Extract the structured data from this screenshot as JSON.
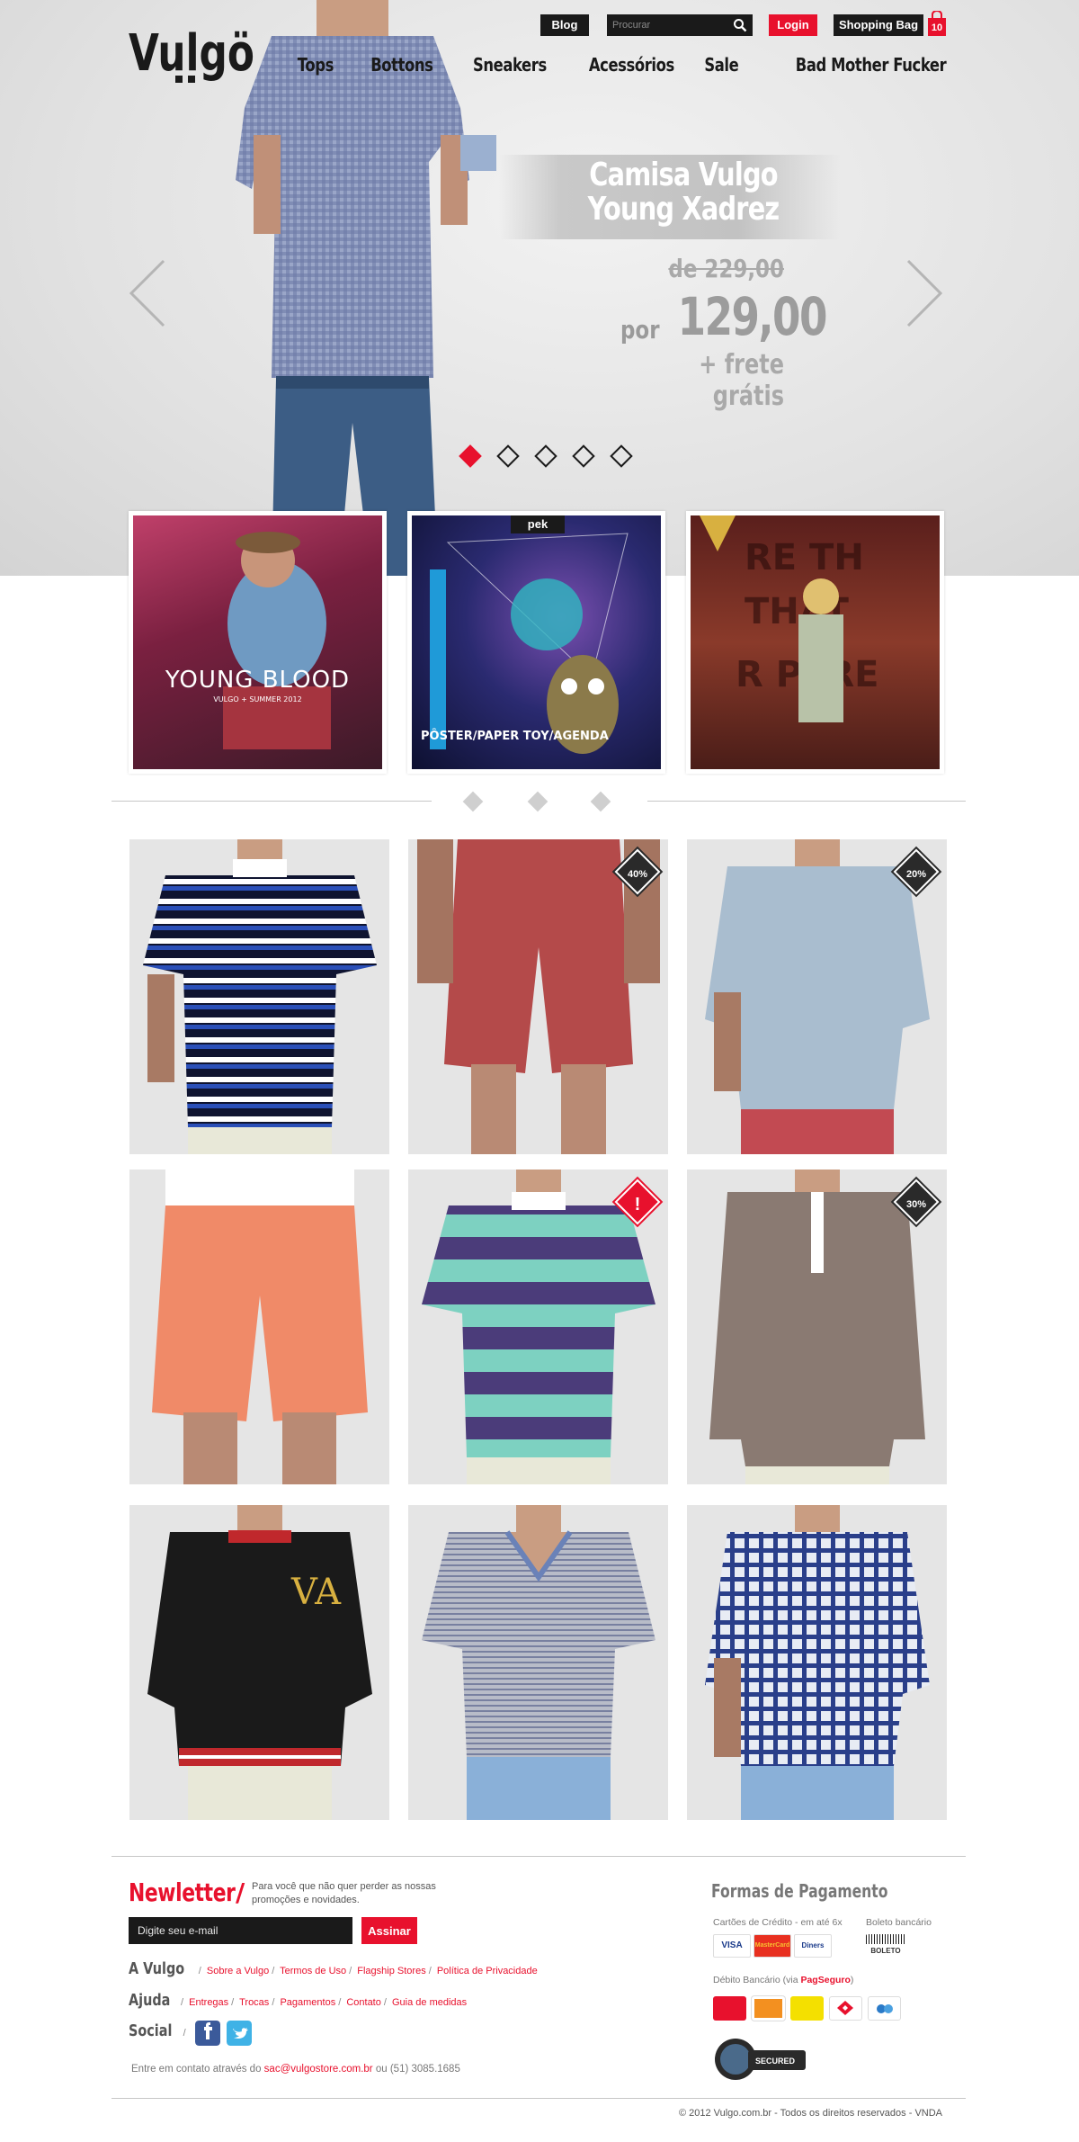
{
  "brand": {
    "logo_text": "Vulgö"
  },
  "header": {
    "blog_label": "Blog",
    "search_placeholder": "Procurar",
    "login_label": "Login",
    "bag_label": "Shopping Bag",
    "bag_count": "10",
    "nav": [
      {
        "label": "Tops"
      },
      {
        "label": "Bottons"
      },
      {
        "label": "Sneakers"
      },
      {
        "label": "Acessórios"
      },
      {
        "label": "Sale"
      },
      {
        "label": "Bad Mother Fucker"
      }
    ]
  },
  "hero": {
    "title_line1": "Camisa Vulgo",
    "title_line2": "Young Xadrez",
    "price_old": "de 229,00",
    "price_prefix": "por",
    "price_new": "129,00",
    "shipping": "+ frete grátis",
    "slides": 5,
    "active_slide": 1
  },
  "features": [
    {
      "caption": "YOUNG BLOOD",
      "sub": "VULGO + SUMMER 2012"
    },
    {
      "caption": "PÔSTER/PAPER TOY/AGENDA",
      "tag": "pek"
    },
    {
      "caption": ""
    }
  ],
  "products": [
    {
      "name": "polo-navy-stripe",
      "badge": ""
    },
    {
      "name": "shorts-red",
      "badge": "40%"
    },
    {
      "name": "shirt-chambray",
      "badge": "20%"
    },
    {
      "name": "shorts-coral",
      "badge": ""
    },
    {
      "name": "polo-purple-mint",
      "badge": "!"
    },
    {
      "name": "henley-brown",
      "badge": "30%"
    },
    {
      "name": "jacket-black",
      "badge": ""
    },
    {
      "name": "tee-v-neck-stripe",
      "badge": ""
    },
    {
      "name": "shirt-blue-check",
      "badge": ""
    }
  ],
  "footer": {
    "newsletter_title": "Newletter",
    "newsletter_sub": "Para você que não quer perder as nossas promoções e novidades.",
    "email_placeholder": "Digite seu e-mail",
    "subscribe_label": "Assinar",
    "vulgo_label": "A Vulgo",
    "vulgo_links": [
      "Sobre a Vulgo",
      "Termos de Uso",
      "Flagship Stores",
      "Política de Privacidade"
    ],
    "help_label": "Ajuda",
    "help_links": [
      "Entregas",
      "Trocas",
      "Pagamentos",
      "Contato",
      "Guia de medidas"
    ],
    "social_label": "Social",
    "contact_prefix": "Entre em contato através do",
    "contact_email": "sac@vulgostore.com.br",
    "contact_suffix": "ou (51) 3085.1685",
    "payment_title": "Formas de Pagamento",
    "credit_label": "Cartões de Crédito - em até 6x",
    "boleto_label": "Boleto bancário",
    "debit_prefix": "Débito Bancário (via",
    "debit_brand": "PagSeguro",
    "debit_suffix": ")",
    "cards": [
      "VISA",
      "MasterCard",
      "Diners"
    ],
    "boleto_text": "BOLETO",
    "secured_text": "SECURED",
    "copyright": "© 2012 Vulgo.com.br - Todos os direitos reservados - VNDA"
  }
}
